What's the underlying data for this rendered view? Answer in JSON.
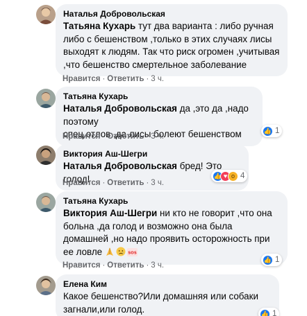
{
  "colors": {
    "bubble": "#f0f2f5",
    "text": "#050505",
    "meta": "#65676b",
    "like": "#1877f2",
    "love": "#f33e58",
    "wow": "#f7b125"
  },
  "actions": {
    "like": "Нравится",
    "reply": "Ответить",
    "separator": "·"
  },
  "comments": [
    {
      "author": "Наталья Добровольская",
      "mention": "Татьяна Кухарь",
      "lines": [
        " тут два варианта : либо ручная",
        "либо с бешенством ,только в этих случаях лисы",
        "выходят к людям. Так что риск огромен ,учитывая",
        ",что бешенство смертельное заболевание"
      ],
      "time": "3 ч."
    },
    {
      "author": "Татьяна Кухарь",
      "mention": "Наталья Добровольская",
      "lines": [
        " да ,это да ,надо поэтому",
        "спец.отлов ,да лисы болеют бешенством"
      ],
      "time": "3 ч.",
      "reactions": {
        "icons": [
          "like-icon"
        ],
        "count": "1"
      }
    },
    {
      "author": "Виктория Аш-Шегри",
      "mention": "Наталья Добровольская",
      "lines": [
        " бред! Это голод!"
      ],
      "time": "3 ч.",
      "reactions": {
        "icons": [
          "like-icon",
          "love-icon",
          "wow-icon"
        ],
        "count": "4"
      }
    },
    {
      "author": "Татьяна Кухарь",
      "mention": "Виктория Аш-Шегри",
      "lines": [
        " ни кто не говорит ,что она",
        "больна ,да голод и возможно она была",
        "домашней ,но надо проявить осторожность при",
        "ее ловле "
      ],
      "emojis": [
        "praying-hands-emoji",
        "sad-face-emoji",
        "sos-emoji"
      ],
      "time": "3 ч.",
      "reactions": {
        "icons": [
          "like-icon"
        ],
        "count": "1"
      }
    },
    {
      "author": "Елена Ким",
      "lines": [
        "Какое бешенство?Или домашняя или собаки",
        "загнали,или голод."
      ],
      "reactions": {
        "icons": [
          "like-icon"
        ],
        "count": "1"
      }
    }
  ]
}
